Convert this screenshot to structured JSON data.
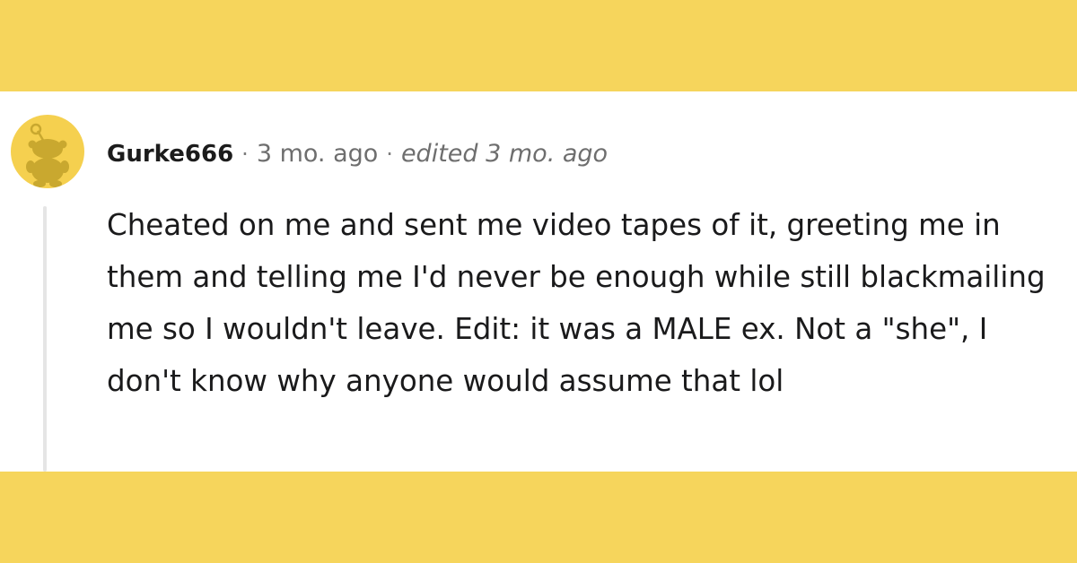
{
  "colors": {
    "banner": "#f6d55c",
    "card": "#ffffff",
    "avatar_bg": "#f5d04f",
    "avatar_figure": "#c9a82f",
    "thread_line": "#e5e5e5"
  },
  "comment": {
    "avatar_icon": "snoo-default-avatar-icon",
    "username": "Gurke666",
    "separator": "·",
    "age": "3 mo. ago",
    "edited": "edited 3 mo. ago",
    "body": "Cheated on me and sent me video tapes of it, greeting me in them and telling me I'd never be enough while still blackmailing me so I wouldn't leave. Edit: it was a MALE ex. Not a \"she\", I don't know why anyone would assume that lol"
  }
}
